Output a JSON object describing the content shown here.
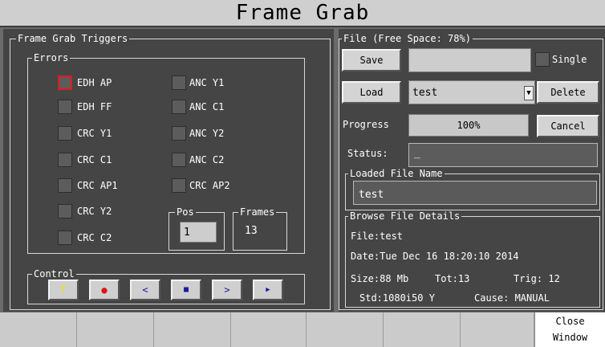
{
  "window": {
    "title": "Frame Grab"
  },
  "triggers": {
    "legend": "Frame Grab Triggers",
    "errors_legend": "Errors",
    "left_col": [
      {
        "label": "EDH AP",
        "selected": true
      },
      {
        "label": "EDH FF",
        "selected": false
      },
      {
        "label": "CRC Y1",
        "selected": false
      },
      {
        "label": "CRC C1",
        "selected": false
      },
      {
        "label": "CRC AP1",
        "selected": false
      },
      {
        "label": "CRC Y2",
        "selected": false
      },
      {
        "label": "CRC C2",
        "selected": false
      }
    ],
    "right_col": [
      {
        "label": "ANC Y1",
        "selected": false
      },
      {
        "label": "ANC C1",
        "selected": false
      },
      {
        "label": "ANC Y2",
        "selected": false
      },
      {
        "label": "ANC C2",
        "selected": false
      },
      {
        "label": "CRC AP2",
        "selected": false
      }
    ],
    "pos": {
      "legend": "Pos",
      "value": "1"
    },
    "frames": {
      "legend": "Frames",
      "value": "13"
    }
  },
  "control": {
    "legend": "Control",
    "buttons": [
      {
        "name": "trigger-button",
        "glyph": "T",
        "color": "#f0e000"
      },
      {
        "name": "record-button",
        "glyph": "●",
        "color": "#e01010"
      },
      {
        "name": "prev-frame-button",
        "glyph": "<",
        "color": "#1a1aa0"
      },
      {
        "name": "stop-button",
        "glyph": "■",
        "color": "#1a1aa0"
      },
      {
        "name": "next-frame-button",
        "glyph": ">",
        "color": "#1a1aa0"
      },
      {
        "name": "play-button",
        "glyph": "▶",
        "color": "#1a1aa0"
      }
    ]
  },
  "file": {
    "legend": "File (Free Space: 78%)",
    "save_label": "Save",
    "save_name": "",
    "single_label": "Single",
    "load_label": "Load",
    "load_value": "test",
    "delete_label": "Delete",
    "progress_label": "Progress",
    "progress_value": "100%",
    "cancel_label": "Cancel",
    "status_label": "Status:",
    "status_value": "_",
    "loaded_legend": "Loaded File Name",
    "loaded_value": "test"
  },
  "details": {
    "legend": "Browse File Details",
    "file": "File:test",
    "date": "Date:Tue Dec 16 18:20:10 2014",
    "size": "Size:88 Mb",
    "tot": "Tot:13",
    "trig": "Trig: 12",
    "std": "Std:1080i50 Y",
    "cause": "Cause: MANUAL"
  },
  "footer": {
    "close_line1": "Close",
    "close_line2": "Window"
  }
}
